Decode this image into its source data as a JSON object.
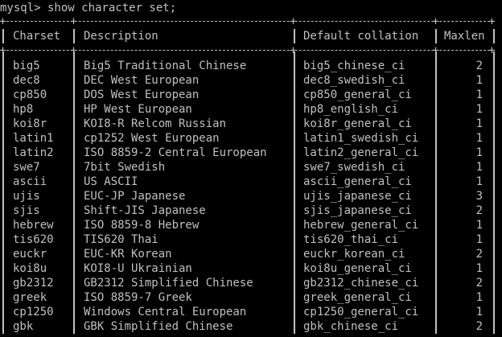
{
  "window": {
    "prompt": "mysql> show character set;"
  },
  "table": {
    "headers": [
      "Charset",
      "Description",
      "Default collation",
      "Maxlen"
    ],
    "rows": [
      [
        "big5",
        "Big5 Traditional Chinese",
        "big5_chinese_ci",
        "2"
      ],
      [
        "dec8",
        "DEC West European",
        "dec8_swedish_ci",
        "1"
      ],
      [
        "cp850",
        "DOS West European",
        "cp850_general_ci",
        "1"
      ],
      [
        "hp8",
        "HP West European",
        "hp8_english_ci",
        "1"
      ],
      [
        "koi8r",
        "KOI8-R Relcom Russian",
        "koi8r_general_ci",
        "1"
      ],
      [
        "latin1",
        "cp1252 West European",
        "latin1_swedish_ci",
        "1"
      ],
      [
        "latin2",
        "ISO 8859-2 Central European",
        "latin2_general_ci",
        "1"
      ],
      [
        "swe7",
        "7bit Swedish",
        "swe7_swedish_ci",
        "1"
      ],
      [
        "ascii",
        "US ASCII",
        "ascii_general_ci",
        "1"
      ],
      [
        "ujis",
        "EUC-JP Japanese",
        "ujis_japanese_ci",
        "3"
      ],
      [
        "sjis",
        "Shift-JIS Japanese",
        "sjis_japanese_ci",
        "2"
      ],
      [
        "hebrew",
        "ISO 8859-8 Hebrew",
        "hebrew_general_ci",
        "1"
      ],
      [
        "tis620",
        "TIS620 Thai",
        "tis620_thai_ci",
        "1"
      ],
      [
        "euckr",
        "EUC-KR Korean",
        "euckr_korean_ci",
        "2"
      ],
      [
        "koi8u",
        "KOI8-U Ukrainian",
        "koi8u_general_ci",
        "1"
      ],
      [
        "gb2312",
        "GB2312 Simplified Chinese",
        "gb2312_chinese_ci",
        "2"
      ],
      [
        "greek",
        "ISO 8859-7 Greek",
        "greek_general_ci",
        "1"
      ],
      [
        "cp1250",
        "Windows Central European",
        "cp1250_general_ci",
        "1"
      ],
      [
        "gbk",
        "GBK Simplified Chinese",
        "gbk_chinese_ci",
        "2"
      ]
    ]
  },
  "colors": {
    "background": "#000000",
    "text": "#c0c0c0"
  }
}
